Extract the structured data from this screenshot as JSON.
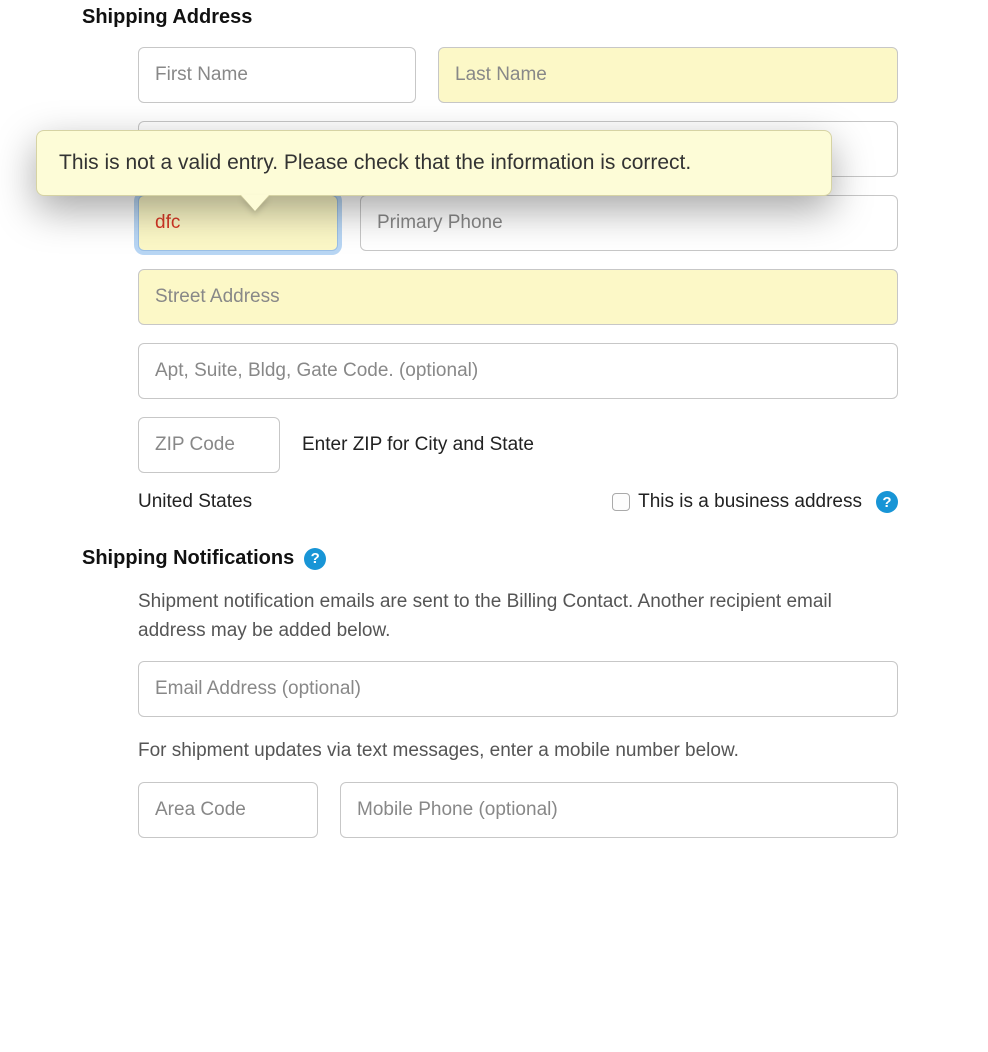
{
  "shipping_address": {
    "title": "Shipping Address",
    "first_name_placeholder": "First Name",
    "last_name_placeholder": "Last Name",
    "area_code_value": "dfc",
    "primary_phone_placeholder": "Primary Phone",
    "street_placeholder": "Street Address",
    "apt_placeholder": "Apt, Suite, Bldg, Gate Code. (optional)",
    "zip_placeholder": "ZIP Code",
    "zip_hint": "Enter ZIP for City and State",
    "country": "United States",
    "business_checkbox_label": "This is a business address",
    "validation_error": "This is not a valid entry. Please check that the information is correct."
  },
  "shipping_notifications": {
    "title": "Shipping Notifications",
    "email_intro": "Shipment notification emails are sent to the Billing Contact. Another recipient email address may be added below.",
    "email_placeholder": "Email Address (optional)",
    "sms_intro": "For shipment updates via text messages, enter a mobile number below.",
    "mobile_area_placeholder": "Area Code",
    "mobile_phone_placeholder": "Mobile Phone (optional)"
  },
  "icons": {
    "help": "?"
  }
}
